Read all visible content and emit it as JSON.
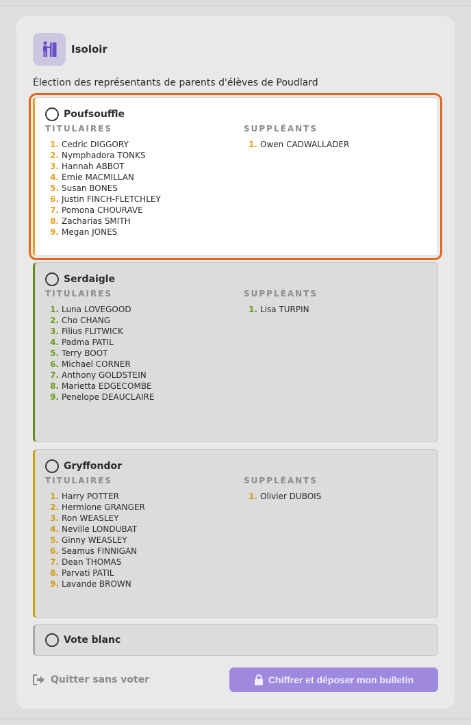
{
  "app": {
    "title": "Isoloir",
    "logo_icon": "voting-booth-icon"
  },
  "election": {
    "title": "Élection des représentants de parents d'élèves de Poudlard"
  },
  "labels": {
    "titulaires": "TITULAIRES",
    "suppleants": "SUPPLÉANTS"
  },
  "options": [
    {
      "name": "Poufsouffle",
      "selected": true,
      "accent": "#e6a11f",
      "num_color": "#e6a11f",
      "titulaires": [
        "Cedric DIGGORY",
        "Nymphadora TONKS",
        "Hannah ABBOT",
        "Ernie MACMILLAN",
        "Susan BONES",
        "Justin FINCH-FLETCHLEY",
        "Pomona CHOURAVE",
        "Zacharias SMITH",
        "Megan JONES"
      ],
      "suppleants": [
        "Owen CADWALLADER"
      ]
    },
    {
      "name": "Serdaigle",
      "selected": false,
      "accent": "#5e8e19",
      "num_color": "#6b9a1d",
      "titulaires": [
        "Luna LOVEGOOD",
        "Cho CHANG",
        "Filius FLITWICK",
        "Padma PATIL",
        "Terry BOOT",
        "Michael CORNER",
        "Anthony GOLDSTEIN",
        "Marietta EDGECOMBE",
        "Penelope DEAUCLAIRE"
      ],
      "suppleants": [
        "Lisa TURPIN"
      ]
    },
    {
      "name": "Gryffondor",
      "selected": false,
      "accent": "#c9a10a",
      "num_color": "#d49a10",
      "titulaires": [
        "Harry POTTER",
        "Hermione GRANGER",
        "Ron WEASLEY",
        "Neville LONDUBAT",
        "Ginny WEASLEY",
        "Seamus FINNIGAN",
        "Dean THOMAS",
        "Parvati PATIL",
        "Lavande BROWN"
      ],
      "suppleants": [
        "Olivier DUBOIS"
      ]
    }
  ],
  "blank_vote": {
    "label": "Vote blanc",
    "accent": "#a8a8a8"
  },
  "footer": {
    "quit_label": "Quitter sans voter",
    "quit_icon": "sign-out-icon",
    "submit_label": "Chiffrer et déposer mon bulletin",
    "submit_icon": "lock-icon"
  },
  "colors": {
    "brand": "#9e89de",
    "selection": "#e2671b"
  }
}
